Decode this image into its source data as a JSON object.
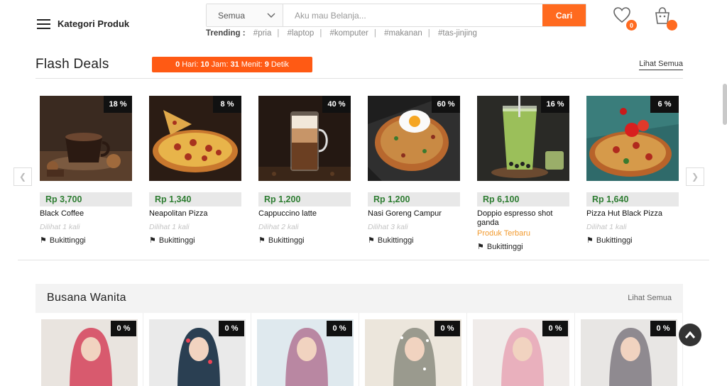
{
  "header": {
    "menu_label": "Kategori Produk",
    "search_category": "Semua",
    "search_placeholder": "Aku mau Belanja...",
    "search_button": "Cari",
    "trending_label": "Trending :",
    "trending_tags": [
      "#pria",
      "#laptop",
      "#komputer",
      "#makanan",
      "#tas-jinjing"
    ],
    "wishlist_count": "0",
    "cart_count": ""
  },
  "flash_deals": {
    "title": "Flash Deals",
    "countdown": {
      "hari": "0",
      "hari_label": "Hari:",
      "jam": "10",
      "jam_label": "Jam:",
      "menit": "31",
      "menit_label": "Menit:",
      "detik": "9",
      "detik_label": "Detik"
    },
    "see_all": "Lihat Semua",
    "products": [
      {
        "name": "Black Coffee",
        "price": "Rp 3,700",
        "discount": "18 %",
        "views": "Dilihat 1 kali",
        "location": "Bukittinggi",
        "tag": ""
      },
      {
        "name": "Neapolitan Pizza",
        "price": "Rp 1,340",
        "discount": "8 %",
        "views": "Dilihat 1 kali",
        "location": "Bukittinggi",
        "tag": ""
      },
      {
        "name": "Cappuccino latte",
        "price": "Rp 1,200",
        "discount": "40 %",
        "views": "Dilihat 2 kali",
        "location": "Bukittinggi",
        "tag": ""
      },
      {
        "name": "Nasi Goreng Campur",
        "price": "Rp 1,200",
        "discount": "60 %",
        "views": "Dilihat 3 kali",
        "location": "Bukittinggi",
        "tag": ""
      },
      {
        "name": "Doppio espresso shot ganda",
        "price": "Rp 6,100",
        "discount": "16 %",
        "views": "",
        "location": "Bukittinggi",
        "tag": "Produk Terbaru"
      },
      {
        "name": "Pizza Hut Black Pizza",
        "price": "Rp 1,640",
        "discount": "6 %",
        "views": "Dilihat 1 kali",
        "location": "Bukittinggi",
        "tag": ""
      }
    ]
  },
  "busana": {
    "title": "Busana Wanita",
    "see_all": "Lihat Semua",
    "items": [
      {
        "discount": "0 %",
        "hijab_color": "#d85a6e"
      },
      {
        "discount": "0 %",
        "hijab_color": "#2a3f52"
      },
      {
        "discount": "0 %",
        "hijab_color": "#b987a2"
      },
      {
        "discount": "0 %",
        "hijab_color": "#9a9a8e"
      },
      {
        "discount": "0 %",
        "hijab_color": "#e9b0bd"
      },
      {
        "discount": "0 %",
        "hijab_color": "#8f8a90"
      }
    ]
  },
  "colors": {
    "accent": "#ff6a1f",
    "price_green": "#2e7d32",
    "new_tag": "#f29a2e"
  }
}
